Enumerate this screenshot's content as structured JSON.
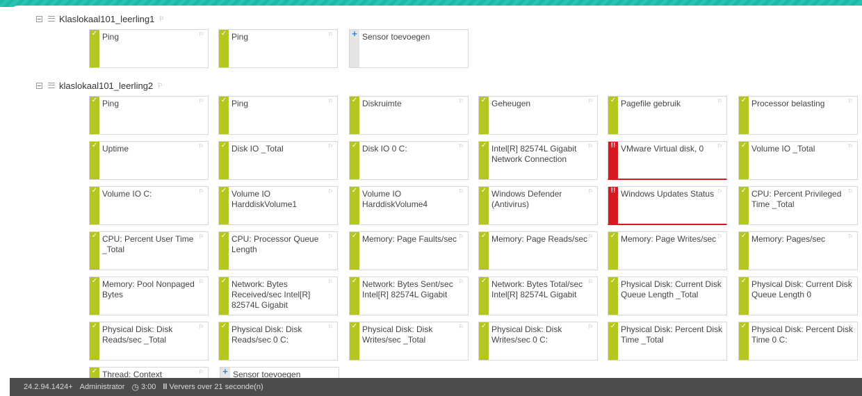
{
  "devices": [
    {
      "name": "Klaslokaal101_leerling1",
      "sensors": [
        "Ping",
        "Ping"
      ],
      "add_label": "Sensor toevoegen"
    },
    {
      "name": "klaslokaal101_leerling2",
      "sensors": [
        "Ping",
        "Ping",
        "Diskruimte",
        "Geheugen",
        "Pagefile gebruik",
        "Processor belasting",
        "Uptime",
        "Disk IO _Total",
        "Disk IO 0 C:",
        "Intel[R] 82574L Gigabit Network Connection",
        "VMware Virtual disk, 0",
        "Volume IO _Total",
        "Volume IO C:",
        "Volume IO HarddiskVolume1",
        "Volume IO HarddiskVolume4",
        "Windows Defender (Antivirus)",
        "Windows Updates Status",
        "CPU: Percent Privileged Time _Total",
        "CPU: Percent User Time _Total",
        "CPU: Processor Queue Length",
        "Memory: Page Faults/sec",
        "Memory: Page Reads/sec",
        "Memory: Page Writes/sec",
        "Memory: Pages/sec",
        "Memory: Pool Nonpaged Bytes",
        "Network: Bytes Received/sec Intel[R] 82574L Gigabit",
        "Network: Bytes Sent/sec Intel[R] 82574L Gigabit",
        "Network: Bytes Total/sec Intel[R] 82574L Gigabit",
        "Physical Disk: Current Disk Queue Length _Total",
        "Physical Disk: Current Disk Queue Length 0",
        "Physical Disk: Disk Reads/sec _Total",
        "Physical Disk: Disk Reads/sec 0 C:",
        "Physical Disk: Disk Writes/sec _Total",
        "Physical Disk: Disk Writes/sec 0 C:",
        "Physical Disk: Percent Disk Time _Total",
        "Physical Disk: Percent Disk Time 0 C:",
        "Thread: Context Switches/sec"
      ],
      "add_label": "Sensor toevoegen"
    }
  ],
  "status": {
    "ok_mark": "✓",
    "down_mark": "!!",
    "add_mark": "+"
  },
  "footer": {
    "version": "24.2.94.1424+",
    "user": "Administrator",
    "time": "3:00",
    "refresh": "Ververs over 21 seconde(n)"
  },
  "colors": {
    "ok": "#b5c71e",
    "down": "#d71920",
    "footer_bg": "#4c4c4c",
    "accent_band": "#1fb8a8"
  },
  "icons": {
    "collapse": "minus-box-icon",
    "device": "device-icon",
    "flag": "flag-icon",
    "clock": "clock-icon",
    "pause": "pause-icon",
    "add": "plus-icon"
  }
}
